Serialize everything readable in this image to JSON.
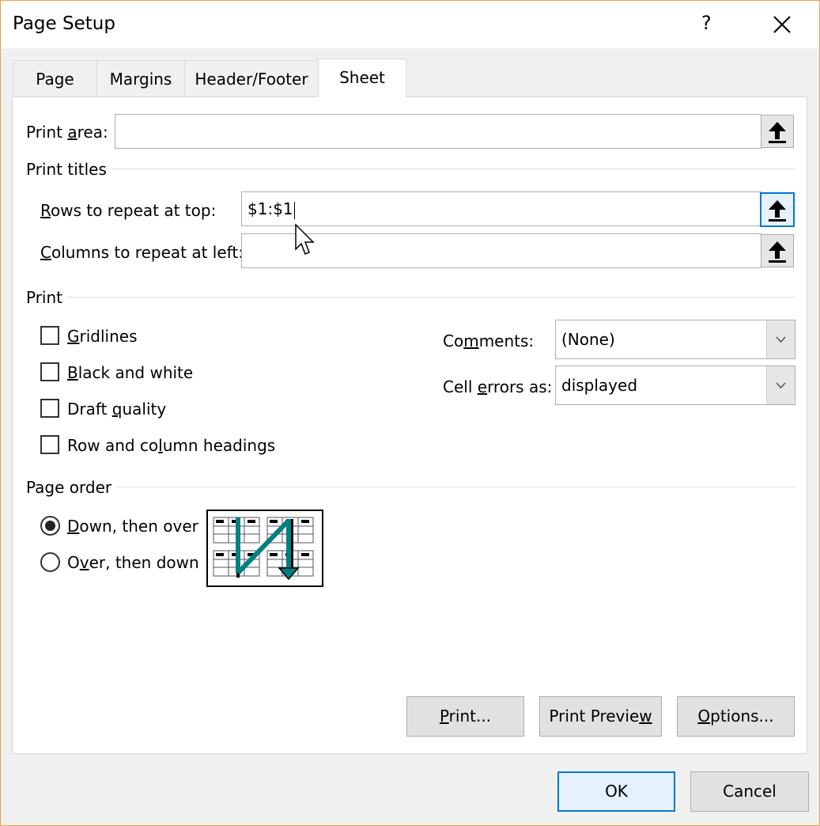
{
  "dialog": {
    "title": "Page Setup",
    "help_label": "?",
    "close_icon": "close-icon"
  },
  "tabs": [
    {
      "label": "Page",
      "active": false
    },
    {
      "label": "Margins",
      "active": false
    },
    {
      "label": "Header/Footer",
      "active": false
    },
    {
      "label": "Sheet",
      "active": true
    }
  ],
  "print_area": {
    "label_pre": "Print ",
    "label_ul": "a",
    "label_post": "rea:",
    "value": ""
  },
  "print_titles": {
    "section_label": "Print titles",
    "rows": {
      "label_ul": "R",
      "label_post": "ows to repeat at top:",
      "value": "$1:$1"
    },
    "columns": {
      "label_ul": "C",
      "label_post": "olumns to repeat at left:",
      "value": ""
    }
  },
  "print": {
    "section_label": "Print",
    "gridlines": {
      "label_ul": "G",
      "label_post": "ridlines",
      "checked": false
    },
    "black_white": {
      "label_ul": "B",
      "label_post": "lack and white",
      "checked": false
    },
    "draft": {
      "label_pre": "Draft ",
      "label_ul": "q",
      "label_post": "uality",
      "checked": false
    },
    "headings": {
      "label_pre": "Row and co",
      "label_ul": "l",
      "label_post": "umn headings",
      "checked": false
    },
    "comments": {
      "label_pre": "Co",
      "label_ul": "m",
      "label_post": "ments:",
      "value": "(None)"
    },
    "cell_errors": {
      "label_pre": "Cell ",
      "label_ul": "e",
      "label_post": "rrors as:",
      "value": "displayed"
    }
  },
  "page_order": {
    "section_label": "Page order",
    "down_then_over": {
      "label_ul": "D",
      "label_post": "own, then over",
      "selected": true
    },
    "over_then_down": {
      "label_pre": "O",
      "label_ul": "v",
      "label_post": "er, then down",
      "selected": false
    },
    "preview_icon": "page-order-preview-icon"
  },
  "buttons": {
    "print": {
      "label_ul": "P",
      "label_post": "rint..."
    },
    "print_preview": {
      "label_pre": "Print Previe",
      "label_ul": "w",
      "label_post": ""
    },
    "options": {
      "label_ul": "O",
      "label_post": "ptions..."
    },
    "ok": "OK",
    "cancel": "Cancel"
  },
  "colors": {
    "accent": "#0078d7",
    "arrow": "#008080",
    "window_border": "#e8a040"
  }
}
